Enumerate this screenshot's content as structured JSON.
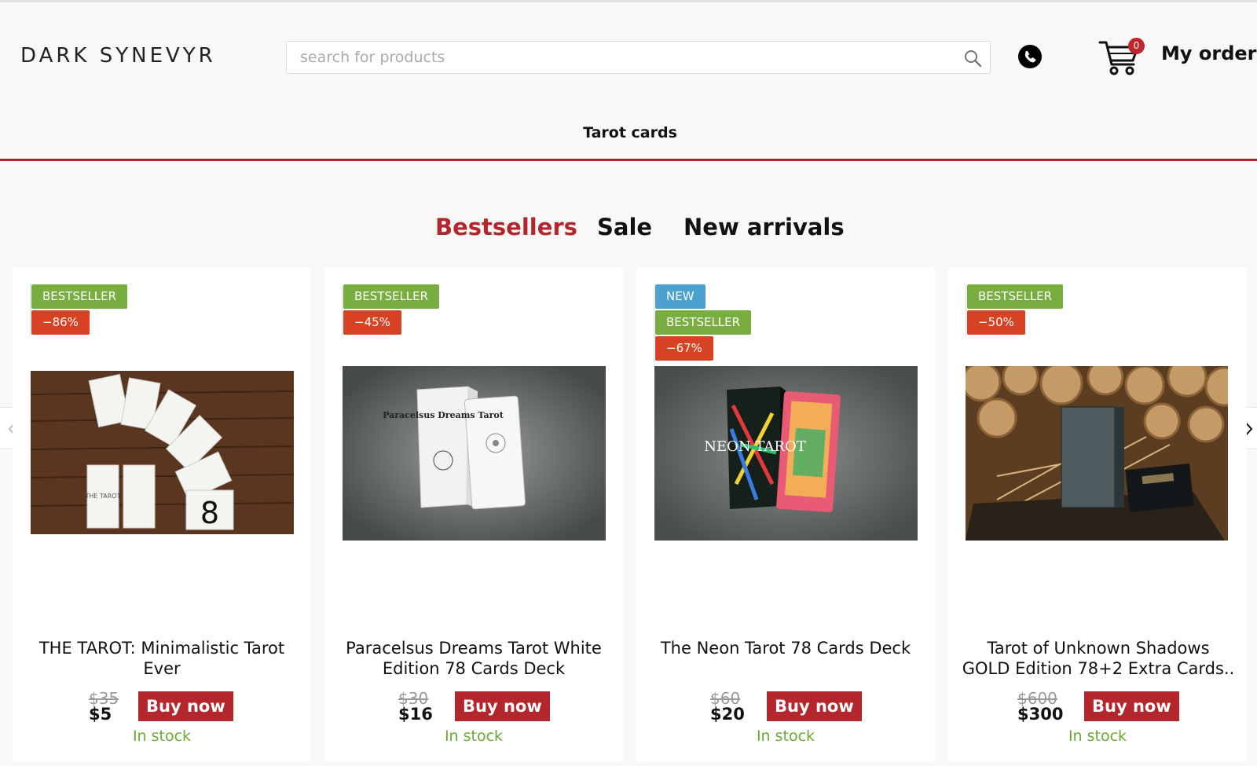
{
  "header": {
    "logo": "DARK SYNEVYR",
    "search_placeholder": "search for products",
    "cart_count": "0",
    "my_order": "My order"
  },
  "nav": {
    "category": "Tarot cards"
  },
  "tabs": [
    {
      "label": "Bestsellers",
      "active": true
    },
    {
      "label": "Sale",
      "active": false
    },
    {
      "label": "New arrivals",
      "active": false
    }
  ],
  "products": [
    {
      "badges": [
        "BESTSELLER",
        "−86%"
      ],
      "title": "THE TAROT: Minimalistic Tarot Ever",
      "old_price": "$35",
      "price": "$5",
      "buy_label": "Buy now",
      "stock": "In stock"
    },
    {
      "badges": [
        "BESTSELLER",
        "−45%"
      ],
      "title": "Paracelsus Dreams Tarot White Edition 78 Cards Deck",
      "old_price": "$30",
      "price": "$16",
      "buy_label": "Buy now",
      "stock": "In stock"
    },
    {
      "badges": [
        "NEW",
        "BESTSELLER",
        "−67%"
      ],
      "title": "The Neon Tarot 78 Cards Deck",
      "old_price": "$60",
      "price": "$20",
      "buy_label": "Buy now",
      "stock": "In stock"
    },
    {
      "badges": [
        "BESTSELLER",
        "−50%"
      ],
      "title": "Tarot of Unknown Shadows GOLD Edition 78+2 Extra Cards..",
      "old_price": "$600",
      "price": "$300",
      "buy_label": "Buy now",
      "stock": "In stock"
    }
  ],
  "image_text": {
    "p1_card": "THE TAROT",
    "p1_num": "8",
    "p2_box": "Paracelsus Dreams Tarot",
    "p3_box": "NEON TAROT"
  },
  "colors": {
    "accent": "#b3262b",
    "bestseller_badge": "#78ad3f",
    "discount_badge": "#d74322",
    "new_badge": "#4aa0cf",
    "in_stock": "#6aaa30"
  }
}
